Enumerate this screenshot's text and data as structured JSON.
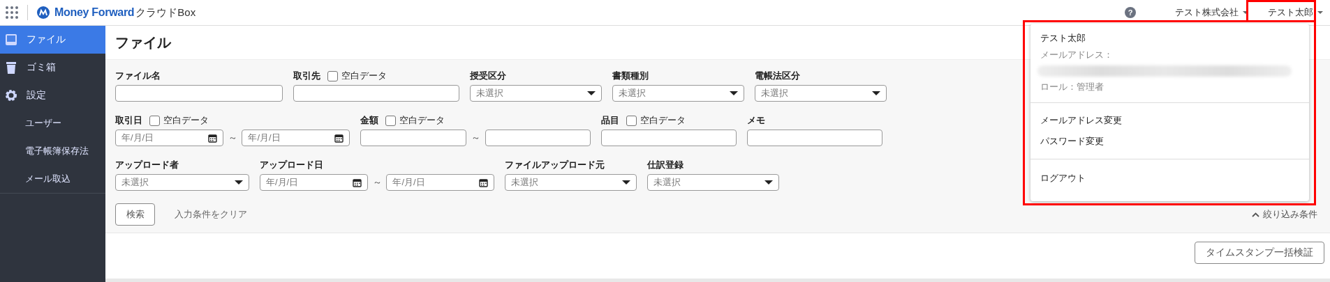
{
  "header": {
    "logo": {
      "brand": "Money Forward",
      "product": "クラウドBox"
    },
    "help": "?",
    "company": "テスト株式会社",
    "user": "テスト太郎"
  },
  "sidebar": {
    "items": [
      {
        "label": "ファイル",
        "selected": true
      },
      {
        "label": "ゴミ箱",
        "selected": false
      },
      {
        "label": "設定",
        "selected": false,
        "children": [
          {
            "label": "ユーザー",
            "selected": false
          },
          {
            "label": "電子帳簿保存法",
            "selected": false
          },
          {
            "label": "メール取込",
            "selected": false
          }
        ]
      }
    ]
  },
  "page_title": "ファイル",
  "filters": [
    [
      {
        "kind": "text",
        "label": "ファイル名"
      },
      {
        "kind": "text",
        "label": "取引先",
        "blank_option": {
          "label": "空白データ",
          "checked": false
        }
      },
      {
        "kind": "select",
        "label": "授受区分",
        "placeholder": "未選択"
      },
      {
        "kind": "select",
        "label": "書類種別",
        "placeholder": "未選択"
      },
      {
        "kind": "select",
        "label": "電帳法区分",
        "placeholder": "未選択"
      }
    ],
    [
      {
        "kind": "daterange",
        "label": "取引日",
        "blank_option": {
          "label": "空白データ",
          "checked": false
        },
        "from_placeholder": "年/月/日",
        "separator": "～",
        "to_placeholder": "年/月/日"
      },
      {
        "kind": "range",
        "label": "金額",
        "blank_option": {
          "label": "空白データ",
          "checked": false
        },
        "separator": "～"
      },
      {
        "kind": "text",
        "label": "品目",
        "blank_option": {
          "label": "空白データ",
          "checked": false
        }
      },
      {
        "kind": "text",
        "label": "メモ"
      }
    ],
    [
      {
        "kind": "select",
        "label": "アップロード者",
        "placeholder": "未選択"
      },
      {
        "kind": "daterange",
        "label": "アップロード日",
        "from_placeholder": "年/月/日",
        "separator": "～",
        "to_placeholder": "年/月/日"
      },
      {
        "kind": "select",
        "label": "ファイルアップロード元",
        "placeholder": "未選択"
      },
      {
        "kind": "select",
        "label": "仕訳登録",
        "placeholder": "未選択"
      }
    ]
  ],
  "search_button": "検索",
  "clear_link": "入力条件をクリア",
  "collapse_toggle": "絞り込み条件",
  "timestamp_button": "タイムスタンプ一括検証",
  "user_menu": {
    "name": "テスト太郎",
    "email_label": "メールアドレス：",
    "role": "ロール：管理者",
    "items": [
      [
        "メールアドレス変更",
        "パスワード変更"
      ],
      [
        "ログアウト"
      ]
    ]
  }
}
